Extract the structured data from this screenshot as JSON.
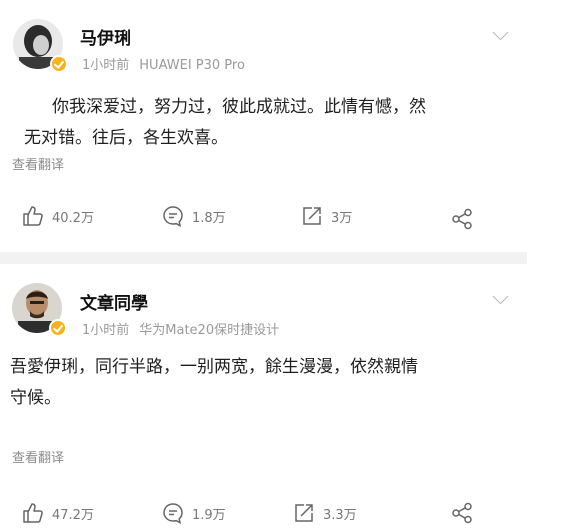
{
  "posts": [
    {
      "username": "马伊琍",
      "time": "1小时前",
      "device": "HUAWEI P30 Pro",
      "content_line1": "你我深爱过，努力过，彼此成就过。此情有憾，然",
      "content_line2": "无对错。往后，各生欢喜。",
      "translate": "查看翻译",
      "likes": "40.2万",
      "comments": "1.8万",
      "reposts": "3万"
    },
    {
      "username": "文章同學",
      "time": "1小时前",
      "device": "华为Mate20保时捷设计",
      "content_line1": "吾愛伊琍，同行半路，一别两宽，餘生漫漫，依然親情",
      "content_line2": "守候。",
      "translate": "查看翻译",
      "likes": "47.2万",
      "comments": "1.9万",
      "reposts": "3.3万"
    }
  ]
}
